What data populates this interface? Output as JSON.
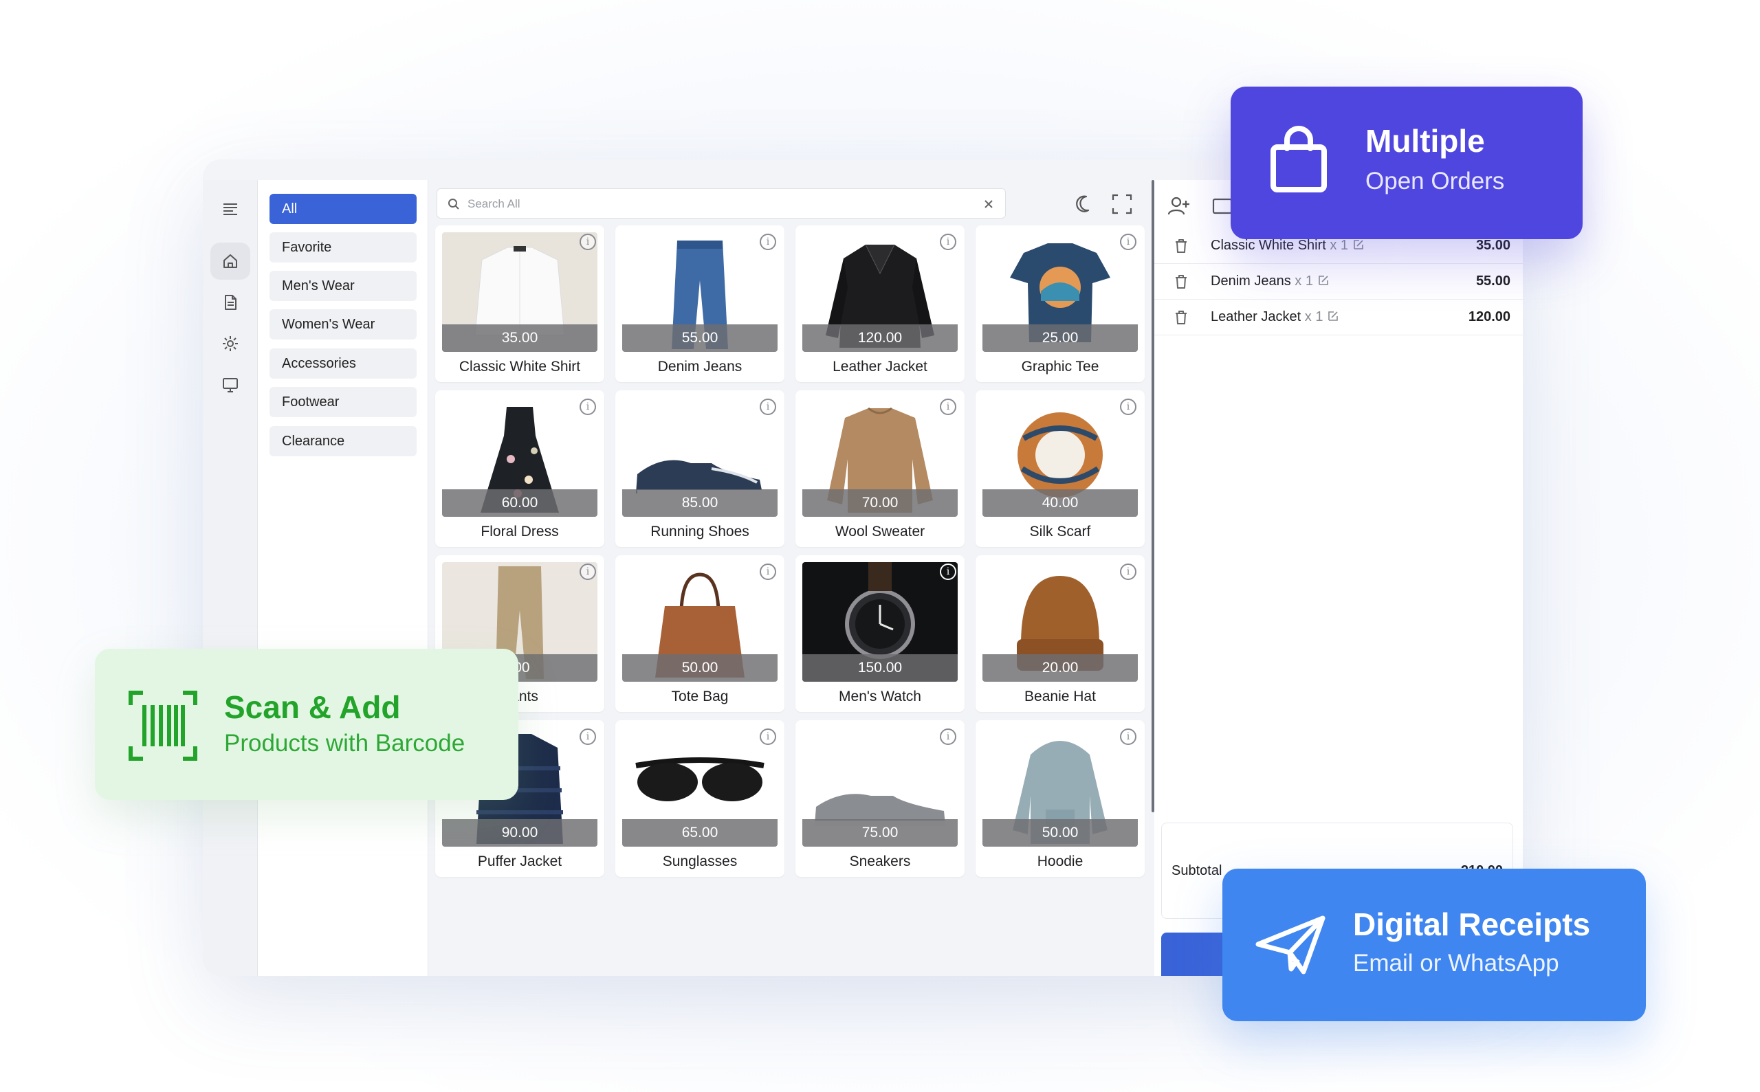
{
  "categories": [
    {
      "label": "All",
      "active": true
    },
    {
      "label": "Favorite"
    },
    {
      "label": "Men's Wear"
    },
    {
      "label": "Women's Wear"
    },
    {
      "label": "Accessories"
    },
    {
      "label": "Footwear"
    },
    {
      "label": "Clearance"
    }
  ],
  "search": {
    "placeholder": "Search All",
    "value": ""
  },
  "products": [
    {
      "name": "Classic White Shirt",
      "price": "35.00"
    },
    {
      "name": "Denim Jeans",
      "price": "55.00"
    },
    {
      "name": "Leather Jacket",
      "price": "120.00"
    },
    {
      "name": "Graphic Tee",
      "price": "25.00"
    },
    {
      "name": "Floral Dress",
      "price": "60.00"
    },
    {
      "name": "Running Shoes",
      "price": "85.00"
    },
    {
      "name": "Wool Sweater",
      "price": "70.00"
    },
    {
      "name": "Silk Scarf",
      "price": "40.00"
    },
    {
      "name": "Pants",
      "price": ".00"
    },
    {
      "name": "Tote Bag",
      "price": "50.00"
    },
    {
      "name": "Men's Watch",
      "price": "150.00"
    },
    {
      "name": "Beanie Hat",
      "price": "20.00"
    },
    {
      "name": "Puffer Jacket",
      "price": "90.00"
    },
    {
      "name": "Sunglasses",
      "price": "65.00"
    },
    {
      "name": "Sneakers",
      "price": "75.00"
    },
    {
      "name": "Hoodie",
      "price": "50.00"
    }
  ],
  "order": {
    "lines": [
      {
        "name": "Classic White Shirt",
        "qty": "x 1",
        "amount": "35.00"
      },
      {
        "name": "Denim Jeans",
        "qty": "x 1",
        "amount": "55.00"
      },
      {
        "name": "Leather Jacket",
        "qty": "x 1",
        "amount": "120.00"
      }
    ],
    "subtotal_label": "Subtotal",
    "subtotal_value": "210.00"
  },
  "callouts": {
    "orders": {
      "title": "Multiple",
      "subtitle": "Open Orders"
    },
    "scan": {
      "title": "Scan & Add",
      "subtitle": "Products with Barcode"
    },
    "receipts": {
      "title": "Digital Receipts",
      "subtitle": "Email or WhatsApp"
    }
  },
  "icons": {
    "menu": "menu-icon",
    "home": "home-icon",
    "document": "document-icon",
    "settings": "gear-icon",
    "display": "monitor-icon",
    "search": "search-icon",
    "clear": "close-icon",
    "theme": "moon-icon",
    "fullscreen": "fullscreen-icon",
    "add_customer": "add-user-icon",
    "trash": "trash-icon",
    "edit": "edit-icon",
    "bag": "shopping-bag-icon",
    "barcode": "barcode-icon",
    "send": "paper-plane-icon"
  },
  "colors": {
    "primary": "#3a63d8",
    "orders_card": "#4f46e0",
    "scan_card": "#e3f6e4",
    "scan_text": "#22a32a",
    "receipts_card": "#3f86f0"
  }
}
